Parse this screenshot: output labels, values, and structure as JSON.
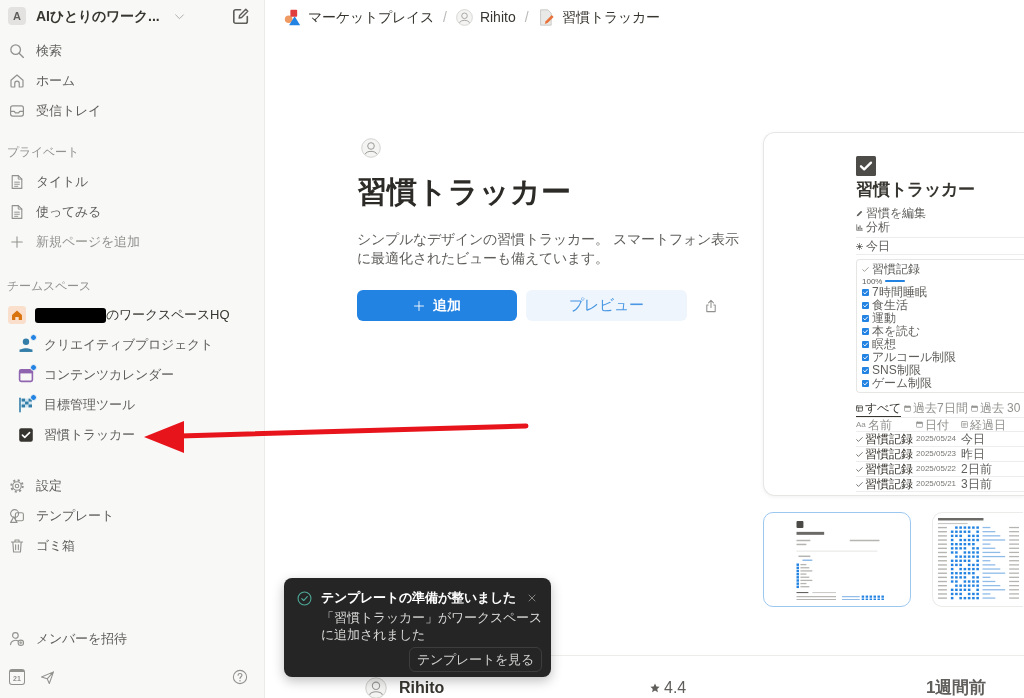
{
  "sidebar": {
    "workspace": {
      "initial": "A",
      "name": "AIひとりのワーク..."
    },
    "nav": [
      {
        "label": "検索"
      },
      {
        "label": "ホーム"
      },
      {
        "label": "受信トレイ"
      }
    ],
    "private": {
      "title": "プライベート",
      "pages": [
        {
          "label": "タイトル"
        },
        {
          "label": "使ってみる"
        }
      ],
      "add_label": "新規ページを追加"
    },
    "teamspace": {
      "title": "チームスペース",
      "redacted": true,
      "name": "のワークスペースHQ",
      "pages": [
        {
          "label": "クリエイティブプロジェクト",
          "unread": true
        },
        {
          "label": "コンテンツカレンダー",
          "unread": true
        },
        {
          "label": "目標管理ツール",
          "unread": true
        },
        {
          "label": "習慣トラッカー",
          "unread": false
        }
      ]
    },
    "tools": [
      {
        "label": "設定"
      },
      {
        "label": "テンプレート"
      },
      {
        "label": "ゴミ箱"
      }
    ],
    "invite": "メンバーを招待",
    "calendar_day": "21"
  },
  "breadcrumb": {
    "items": [
      {
        "label": "マーケットプレイス"
      },
      {
        "label": "Rihito"
      },
      {
        "label": "習慣トラッカー"
      }
    ],
    "separators": [
      "/",
      "/"
    ]
  },
  "template": {
    "title": "習慣トラッカー",
    "description": "シンプルなデザインの習慣トラッカー。 スマートフォン表示に最適化されたビューも備えています。",
    "add_button": "追加",
    "preview_button": "プレビュー"
  },
  "preview": {
    "title": "習慣トラッカー",
    "links": [
      "習慣を編集",
      "分析"
    ],
    "view": "今日",
    "habits_title": "習慣記録",
    "progress": {
      "label": "100%",
      "level": 1
    },
    "habits": [
      {
        "label": "7時間睡眠",
        "checked": true
      },
      {
        "label": "食生活",
        "checked": true
      },
      {
        "label": "運動",
        "checked": true
      },
      {
        "label": "本を読む",
        "checked": true
      },
      {
        "label": "瞑想",
        "checked": true
      },
      {
        "label": "アルコール制限",
        "checked": true
      },
      {
        "label": "SNS制限",
        "checked": true
      },
      {
        "label": "ゲーム制限",
        "checked": true
      }
    ],
    "tabs": [
      {
        "label": "すべて",
        "selected": true
      },
      {
        "label": "過去7日間",
        "selected": false
      },
      {
        "label": "過去 30",
        "selected": false
      }
    ],
    "columns": [
      {
        "type_mark": "Aa",
        "label": "名前"
      },
      {
        "label": "日付"
      },
      {
        "label": "経過日"
      }
    ],
    "rows": [
      {
        "name": "習慣記録",
        "date": "2025/05/24",
        "elapsed": "今日"
      },
      {
        "name": "習慣記録",
        "date": "2025/05/23",
        "elapsed": "昨日"
      },
      {
        "name": "習慣記録",
        "date": "2025/05/22",
        "elapsed": "2日前"
      },
      {
        "name": "習慣記録",
        "date": "2025/05/21",
        "elapsed": "3日前"
      }
    ]
  },
  "thumbnails": [
    {
      "selected": true
    },
    {
      "selected": false
    }
  ],
  "info": {
    "creator": "Rihito",
    "rating": "4.4",
    "updated": "1週間前"
  },
  "toast": {
    "title": "テンプレートの準備が整いました",
    "message": "「習慣トラッカー」がワークスペースに追加されました",
    "action": "テンプレートを見る"
  }
}
